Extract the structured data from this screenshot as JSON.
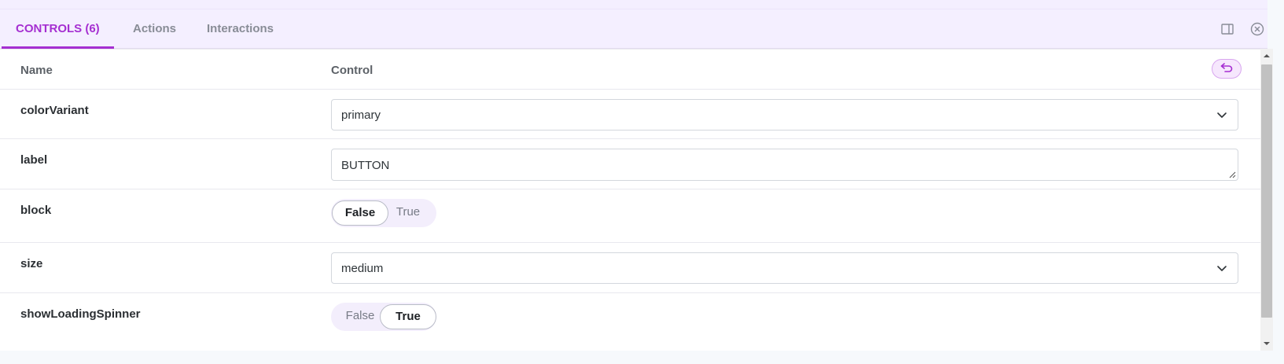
{
  "tabs": [
    {
      "label": "CONTROLS (6)",
      "active": true
    },
    {
      "label": "Actions",
      "active": false
    },
    {
      "label": "Interactions",
      "active": false
    }
  ],
  "toolbar_icons": [
    "panel-layout-icon",
    "close-circle-icon"
  ],
  "table": {
    "header_name": "Name",
    "header_control": "Control",
    "reset_icon": "undo-icon"
  },
  "controls": [
    {
      "name": "colorVariant",
      "type": "select",
      "value": "primary"
    },
    {
      "name": "label",
      "type": "text",
      "value": "BUTTON"
    },
    {
      "name": "block",
      "type": "boolean",
      "options": [
        "False",
        "True"
      ],
      "selected": "False"
    },
    {
      "name": "size",
      "type": "select",
      "value": "medium"
    },
    {
      "name": "showLoadingSpinner",
      "type": "boolean",
      "options": [
        "False",
        "True"
      ],
      "selected": "True"
    }
  ],
  "colors": {
    "accent": "#a52fd1",
    "tab_bar_bg": "#f4efff",
    "toggle_bg": "#f3eefc"
  }
}
